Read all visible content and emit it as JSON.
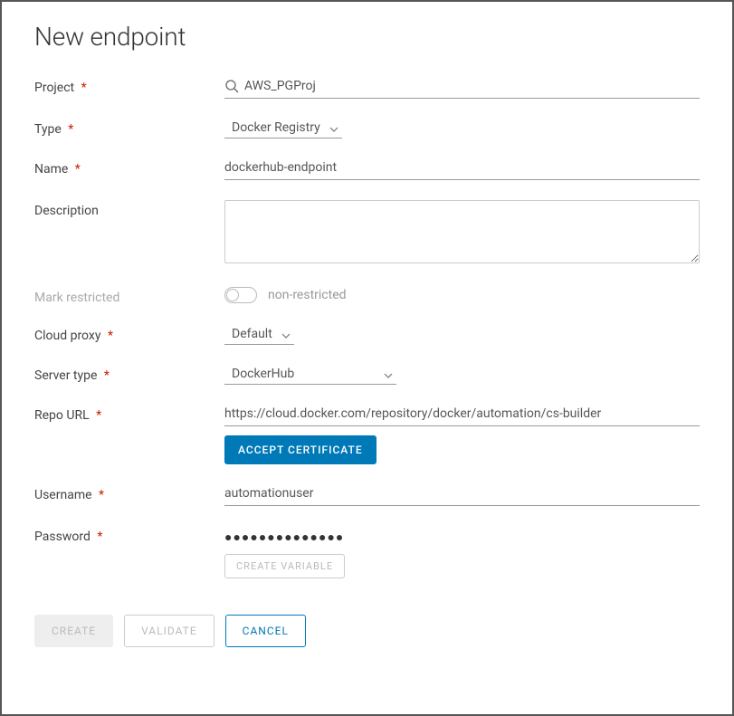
{
  "title": "New endpoint",
  "labels": {
    "project": "Project",
    "type": "Type",
    "name": "Name",
    "description": "Description",
    "mark_restricted": "Mark restricted",
    "cloud_proxy": "Cloud proxy",
    "server_type": "Server type",
    "repo_url": "Repo URL",
    "username": "Username",
    "password": "Password"
  },
  "values": {
    "project": "AWS_PGProj",
    "type": "Docker Registry",
    "name": "dockerhub-endpoint",
    "description": "",
    "restricted_label": "non-restricted",
    "cloud_proxy": "Default",
    "server_type": "DockerHub",
    "repo_url": "https://cloud.docker.com/repository/docker/automation/cs-builder",
    "username": "automationuser",
    "password_display": "●●●●●●●●●●●●●●"
  },
  "buttons": {
    "accept_certificate": "ACCEPT CERTIFICATE",
    "create_variable": "CREATE VARIABLE",
    "create": "CREATE",
    "validate": "VALIDATE",
    "cancel": "CANCEL"
  },
  "asterisk": "*"
}
